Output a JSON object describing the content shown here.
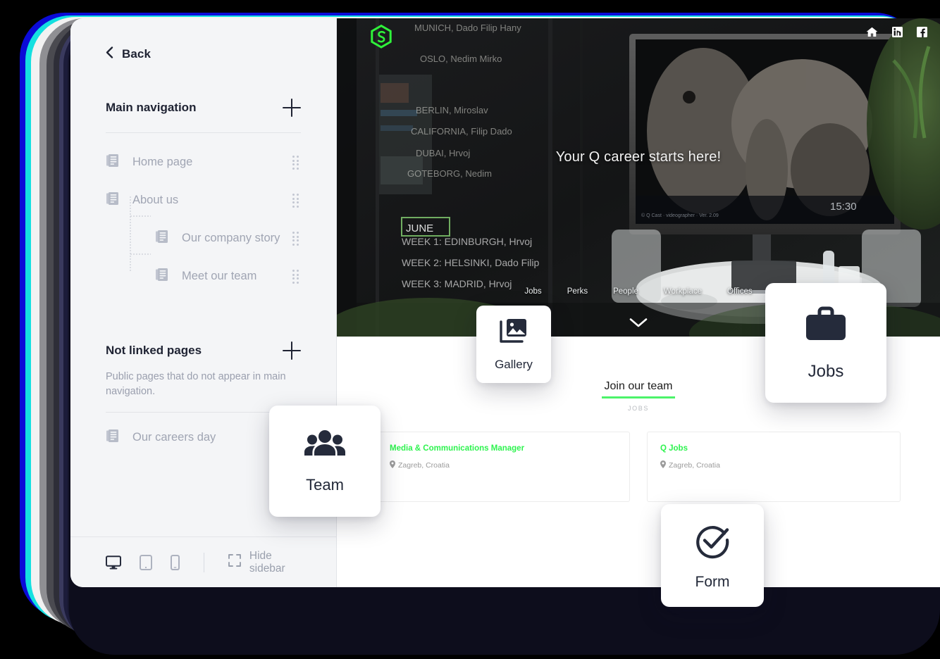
{
  "sidebar": {
    "back_label": "Back",
    "main_nav": {
      "title": "Main navigation",
      "add_label": "+"
    },
    "nav_items": [
      {
        "label": "Home page",
        "level": 0
      },
      {
        "label": "About us",
        "level": 0
      },
      {
        "label": "Our company story",
        "level": 1
      },
      {
        "label": "Meet our team",
        "level": 1
      }
    ],
    "not_linked": {
      "title": "Not linked pages",
      "description": "Public pages that do not appear in main navigation.",
      "add_label": "+"
    },
    "not_linked_items": [
      {
        "label": "Our careers day",
        "level": 0
      }
    ],
    "footer": {
      "hide_sidebar_label": "Hide sidebar",
      "devices": [
        "desktop-icon",
        "tablet-icon",
        "mobile-icon"
      ]
    }
  },
  "preview": {
    "logo_name": "hexagon-logo-icon",
    "social_icons": [
      "home-icon",
      "linkedin-icon",
      "facebook-icon"
    ],
    "hero_title": "Your Q career starts here!",
    "hero_nav": [
      "Jobs",
      "Perks",
      "People",
      "Workplace",
      "Offices"
    ],
    "scroll_indicator": "chevron-down-icon",
    "section": {
      "title": "Join our team",
      "subtitle": "JOBS"
    },
    "jobs": [
      {
        "title": "Media & Communications Manager",
        "location": "Zagreb, Croatia"
      },
      {
        "title": "Q Jobs",
        "location": "Zagreb, Croatia"
      }
    ]
  },
  "feature_cards": [
    {
      "label": "Gallery",
      "icon": "gallery-icon"
    },
    {
      "label": "Team",
      "icon": "team-icon"
    },
    {
      "label": "Jobs",
      "icon": "briefcase-icon"
    },
    {
      "label": "Form",
      "icon": "check-circle-icon"
    }
  ],
  "colors": {
    "accent_green": "#2ef34f",
    "sidebar_bg": "#f4f5f7",
    "text_dark": "#1f2333",
    "text_muted": "#a0a5b3"
  }
}
